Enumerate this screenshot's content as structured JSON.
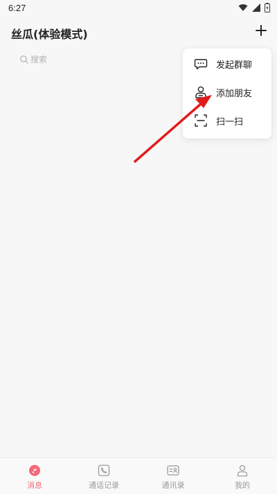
{
  "status_bar": {
    "time": "6:27"
  },
  "header": {
    "title": "丝瓜(体验模式)"
  },
  "search": {
    "placeholder": "搜索"
  },
  "popup_menu": {
    "items": [
      {
        "label": "发起群聊",
        "icon": "chat-bubble-icon"
      },
      {
        "label": "添加朋友",
        "icon": "add-friend-icon"
      },
      {
        "label": "扫一扫",
        "icon": "scan-icon"
      }
    ]
  },
  "tab_bar": {
    "tabs": [
      {
        "label": "消息",
        "icon": "message-icon",
        "active": true
      },
      {
        "label": "通话记录",
        "icon": "call-record-icon",
        "active": false
      },
      {
        "label": "通讯录",
        "icon": "contacts-icon",
        "active": false
      },
      {
        "label": "我的",
        "icon": "profile-icon",
        "active": false
      }
    ]
  },
  "colors": {
    "accent": "#f06a78",
    "arrow": "#e11b1b"
  }
}
